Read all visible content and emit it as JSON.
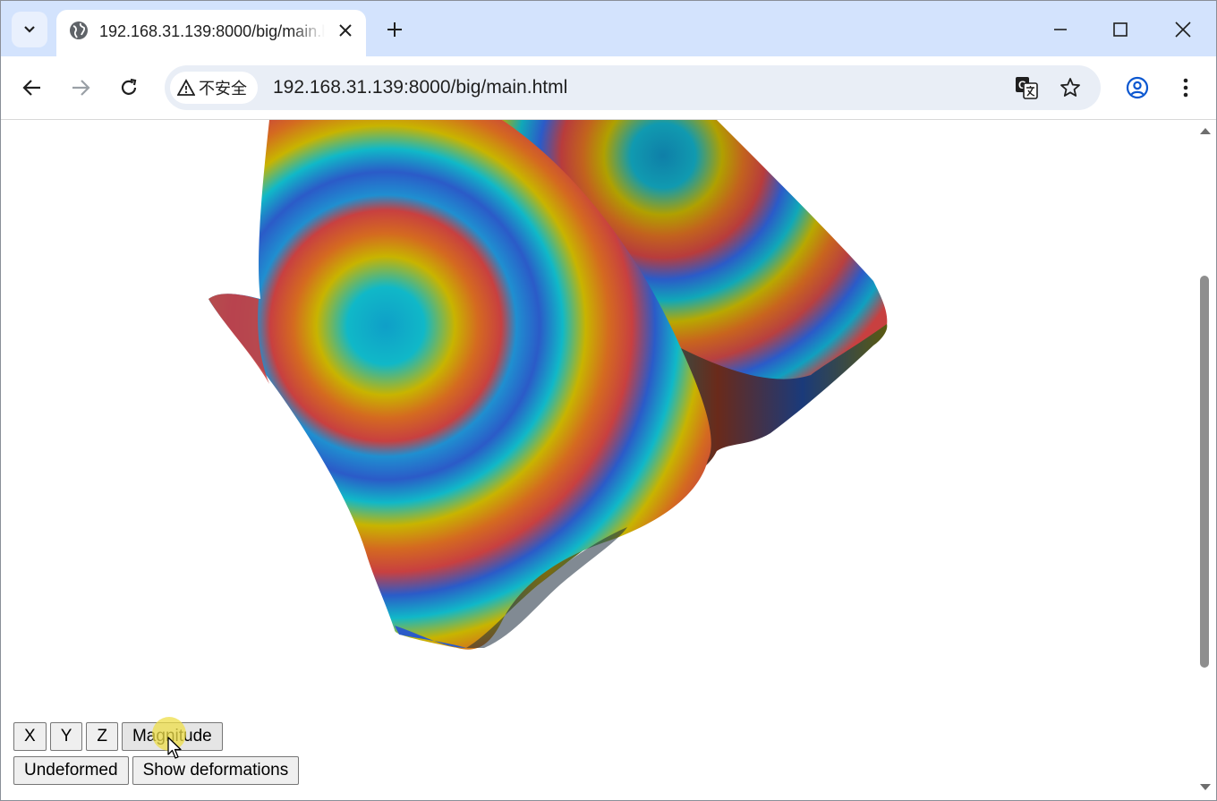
{
  "browser": {
    "tab": {
      "title": "192.168.31.139:8000/big/main.html",
      "favicon": "globe-icon"
    },
    "window_controls": [
      "minimize-icon",
      "maximize-icon",
      "close-icon"
    ],
    "security_label": "不安全",
    "url": "192.168.31.139:8000/big/main.html",
    "omnibox_icons": [
      "translate-icon",
      "bookmark-star-icon"
    ],
    "toolbar_icons": [
      "back-icon",
      "forward-icon",
      "reload-icon",
      "profile-icon",
      "menu-icon"
    ]
  },
  "page": {
    "buttons_row1": {
      "x": "X",
      "y": "Y",
      "z": "Z",
      "magnitude": "Magnitude"
    },
    "buttons_row2": {
      "undeformed": "Undeformed",
      "show_deformations": "Show deformations"
    },
    "hovered_button": "Magnitude"
  },
  "colors": {
    "tabbar_bg": "#d3e3fd",
    "omnibox_bg": "#e9eef6",
    "contour_palette": [
      "#2b5bc8",
      "#1f8fd0",
      "#10b8c8",
      "#c8b400",
      "#d46a20",
      "#c84040"
    ]
  }
}
